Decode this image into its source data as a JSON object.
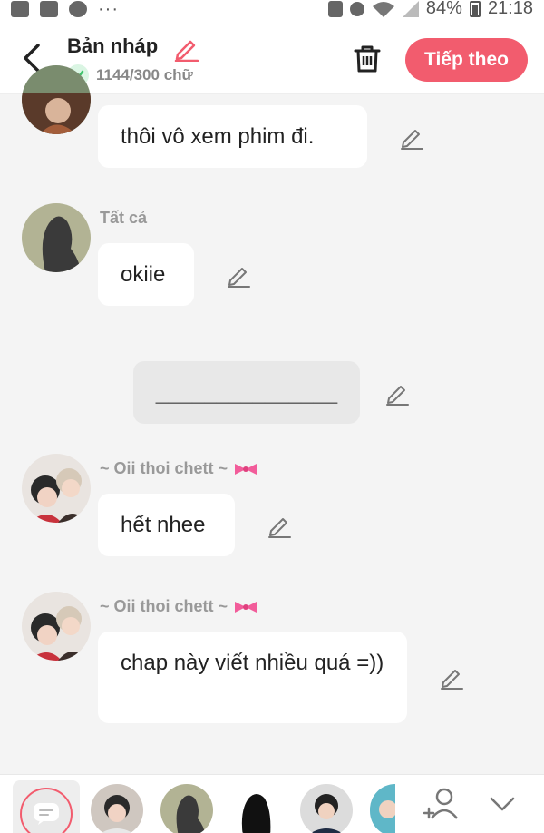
{
  "status_bar": {
    "battery": "84%",
    "time": "21:18"
  },
  "header": {
    "title": "Bản nháp",
    "word_count": "1144/300 chữ",
    "next_label": "Tiếp theo"
  },
  "messages": [
    {
      "text": "thôi vô xem phim đi."
    },
    {
      "sender": "Tất cả",
      "text": "okiie"
    },
    {
      "text": "_______________"
    },
    {
      "sender": "~ Oii thoi chett ~",
      "text": "hết nhee"
    },
    {
      "sender": "~ Oii thoi chett ~",
      "text": "chap này viết nhiều quá =))"
    }
  ],
  "colors": {
    "accent": "#f25c6e",
    "check": "#3cc36a"
  }
}
